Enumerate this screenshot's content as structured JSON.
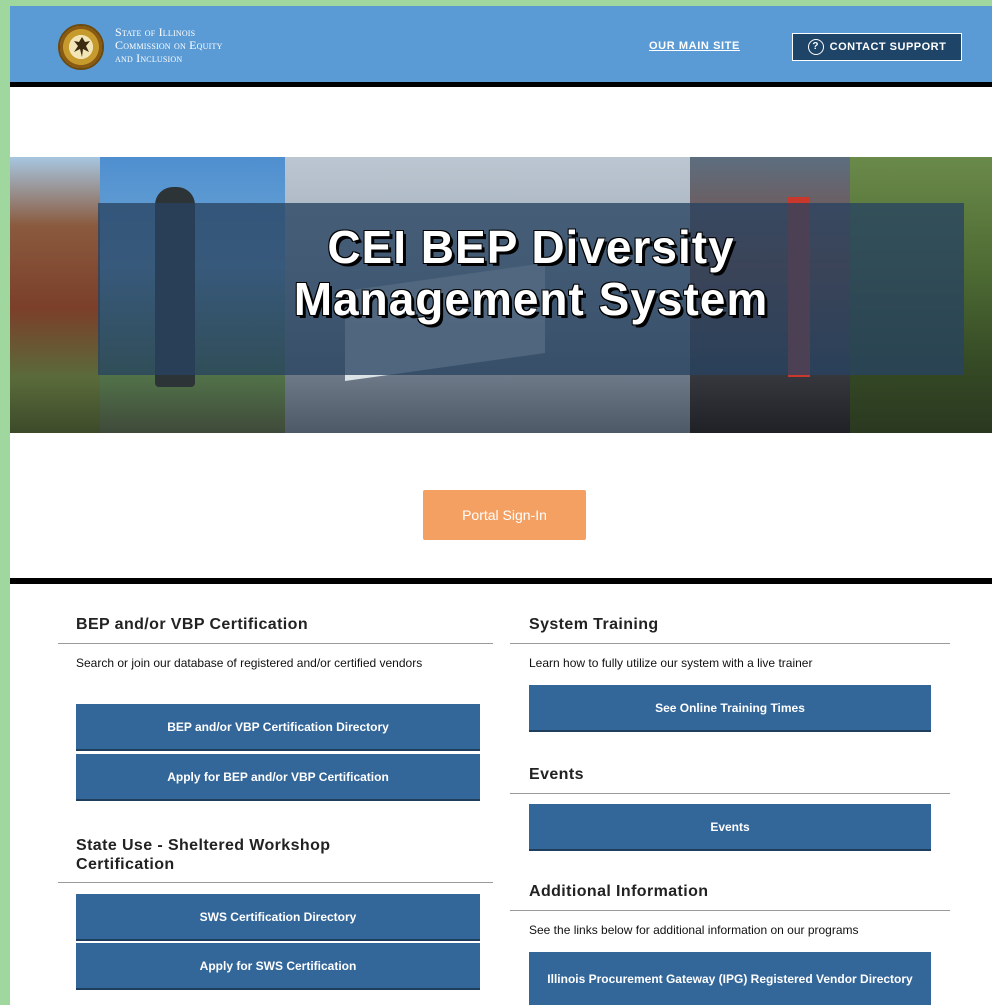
{
  "header": {
    "org_line1": "State of Illinois",
    "org_line2": "Commission on Equity",
    "org_line3": "and Inclusion",
    "main_site_link": "OUR MAIN SITE",
    "contact_support": "CONTACT SUPPORT",
    "contact_icon_glyph": "?",
    "background_color": "#5b9bd5"
  },
  "hero": {
    "title_line1": "CEI BEP Diversity",
    "title_line2": "Management System"
  },
  "signin": {
    "label": "Portal Sign-In",
    "color": "#f4a062"
  },
  "left_column": {
    "certification": {
      "title": "BEP and/or VBP Certification",
      "description": "Search or join our database of registered and/or certified vendors",
      "directory_button": "BEP and/or VBP Certification Directory",
      "apply_button": "Apply for BEP and/or VBP Certification"
    },
    "sws": {
      "title": "State Use - Sheltered Workshop Certification",
      "directory_button": "SWS Certification Directory",
      "apply_button": "Apply for SWS Certification"
    }
  },
  "right_column": {
    "training": {
      "title": "System Training",
      "description": "Learn how to fully utilize our system with a live trainer",
      "button": "See Online Training Times"
    },
    "events": {
      "title": "Events",
      "button": "Events"
    },
    "additional": {
      "title": "Additional Information",
      "description": "See the links below for additional information on our programs",
      "ipg_button": "Illinois Procurement Gateway (IPG) Registered Vendor Directory"
    }
  },
  "colors": {
    "button_blue": "#336699",
    "page_border_green": "#9fd79f"
  }
}
